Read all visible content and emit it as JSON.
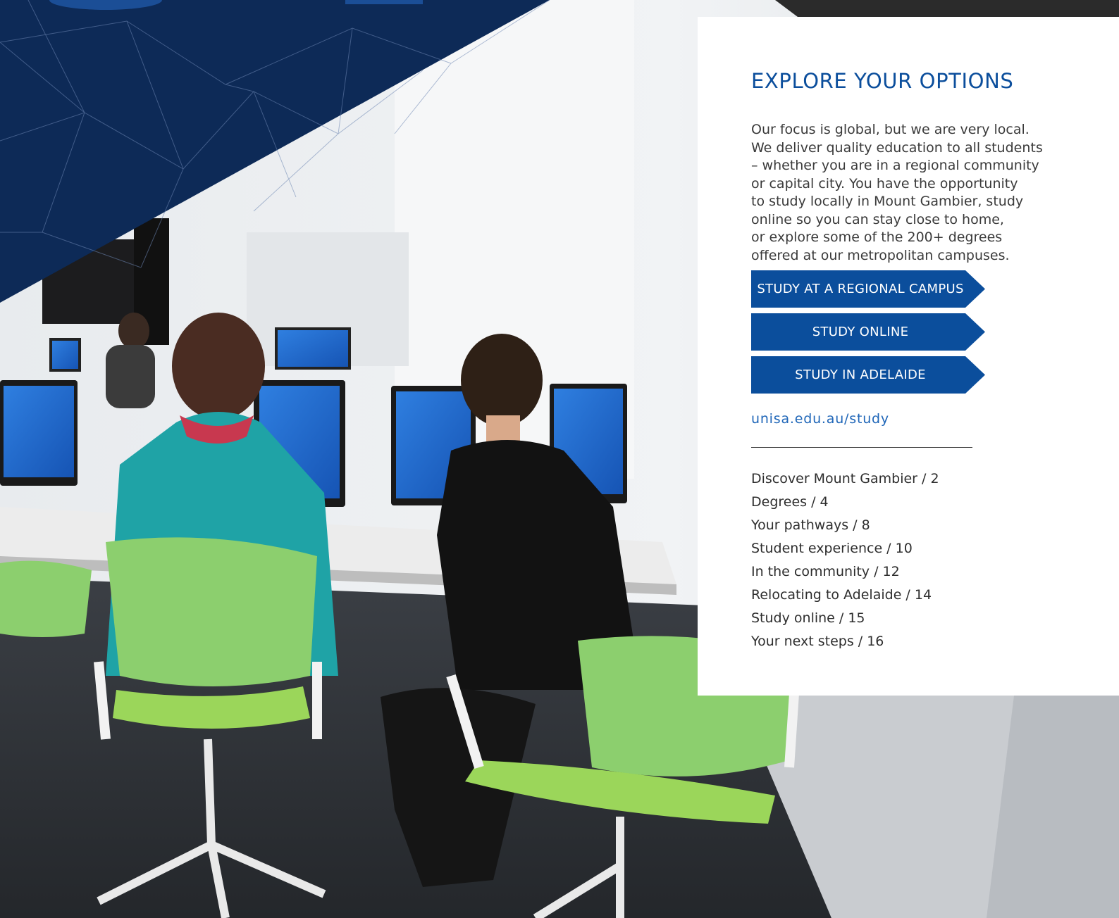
{
  "panel": {
    "heading": "EXPLORE YOUR OPTIONS",
    "intro_lines": [
      "Our focus is global, but we are very local.",
      "We deliver quality education to all students",
      "– whether you are in a regional community",
      "or capital city. You have the opportunity",
      "to study locally in Mount Gambier, study",
      "online so you can stay close to home,",
      "or explore some of the 200+ degrees",
      "offered at our metropolitan campuses."
    ],
    "buttons": {
      "regional": "STUDY AT A REGIONAL CAMPUS",
      "online": "STUDY ONLINE",
      "adelaide": "STUDY IN ADELAIDE"
    },
    "link": "unisa.edu.au/study",
    "contents": [
      "Discover Mount Gambier / 2",
      "Degrees / 4",
      "Your pathways / 8",
      "Student experience / 10",
      "In the community  / 12",
      "Relocating to Adelaide / 14",
      "Study online / 15",
      "Your next steps / 16"
    ]
  },
  "colors": {
    "brand_blue": "#0b4e9c",
    "navy_triangle": "#0d2a57",
    "link_blue": "#1f66b8"
  },
  "icons": {
    "button_arrow": "chevron-arrow-shape"
  }
}
